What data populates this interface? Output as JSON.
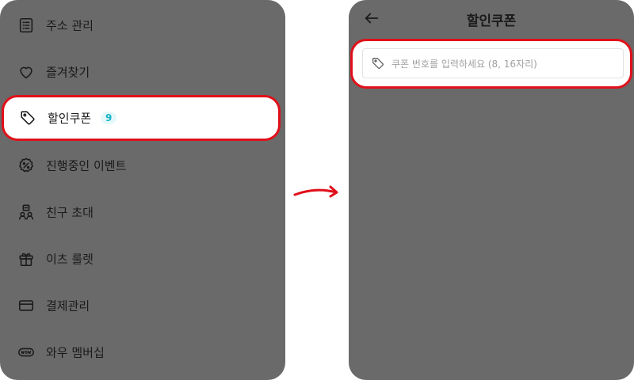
{
  "left_panel": {
    "menu_items": [
      {
        "label": "주소 관리",
        "icon": "address-list-icon"
      },
      {
        "label": "즐겨찾기",
        "icon": "heart-icon"
      },
      {
        "label": "할인쿠폰",
        "icon": "tag-icon",
        "badge": "9",
        "highlighted": true
      },
      {
        "label": "진행중인 이벤트",
        "icon": "percent-badge-icon"
      },
      {
        "label": "친구 초대",
        "icon": "friends-icon"
      },
      {
        "label": "이츠 룰렛",
        "icon": "gift-icon"
      },
      {
        "label": "결제관리",
        "icon": "card-icon"
      },
      {
        "label": "와우 멤버십",
        "icon": "wow-icon"
      }
    ]
  },
  "right_panel": {
    "header": {
      "title": "할인쿠폰",
      "back_icon": "arrow-left-icon"
    },
    "coupon_input": {
      "placeholder": "쿠폰 번호를 입력하세요 (8, 16자리)",
      "value": "",
      "icon": "tag-icon"
    }
  },
  "colors": {
    "overlay": "#6a6a6a",
    "highlight_border": "#e0101a",
    "badge_text": "#16b3c4",
    "arrow": "#e0101a"
  }
}
